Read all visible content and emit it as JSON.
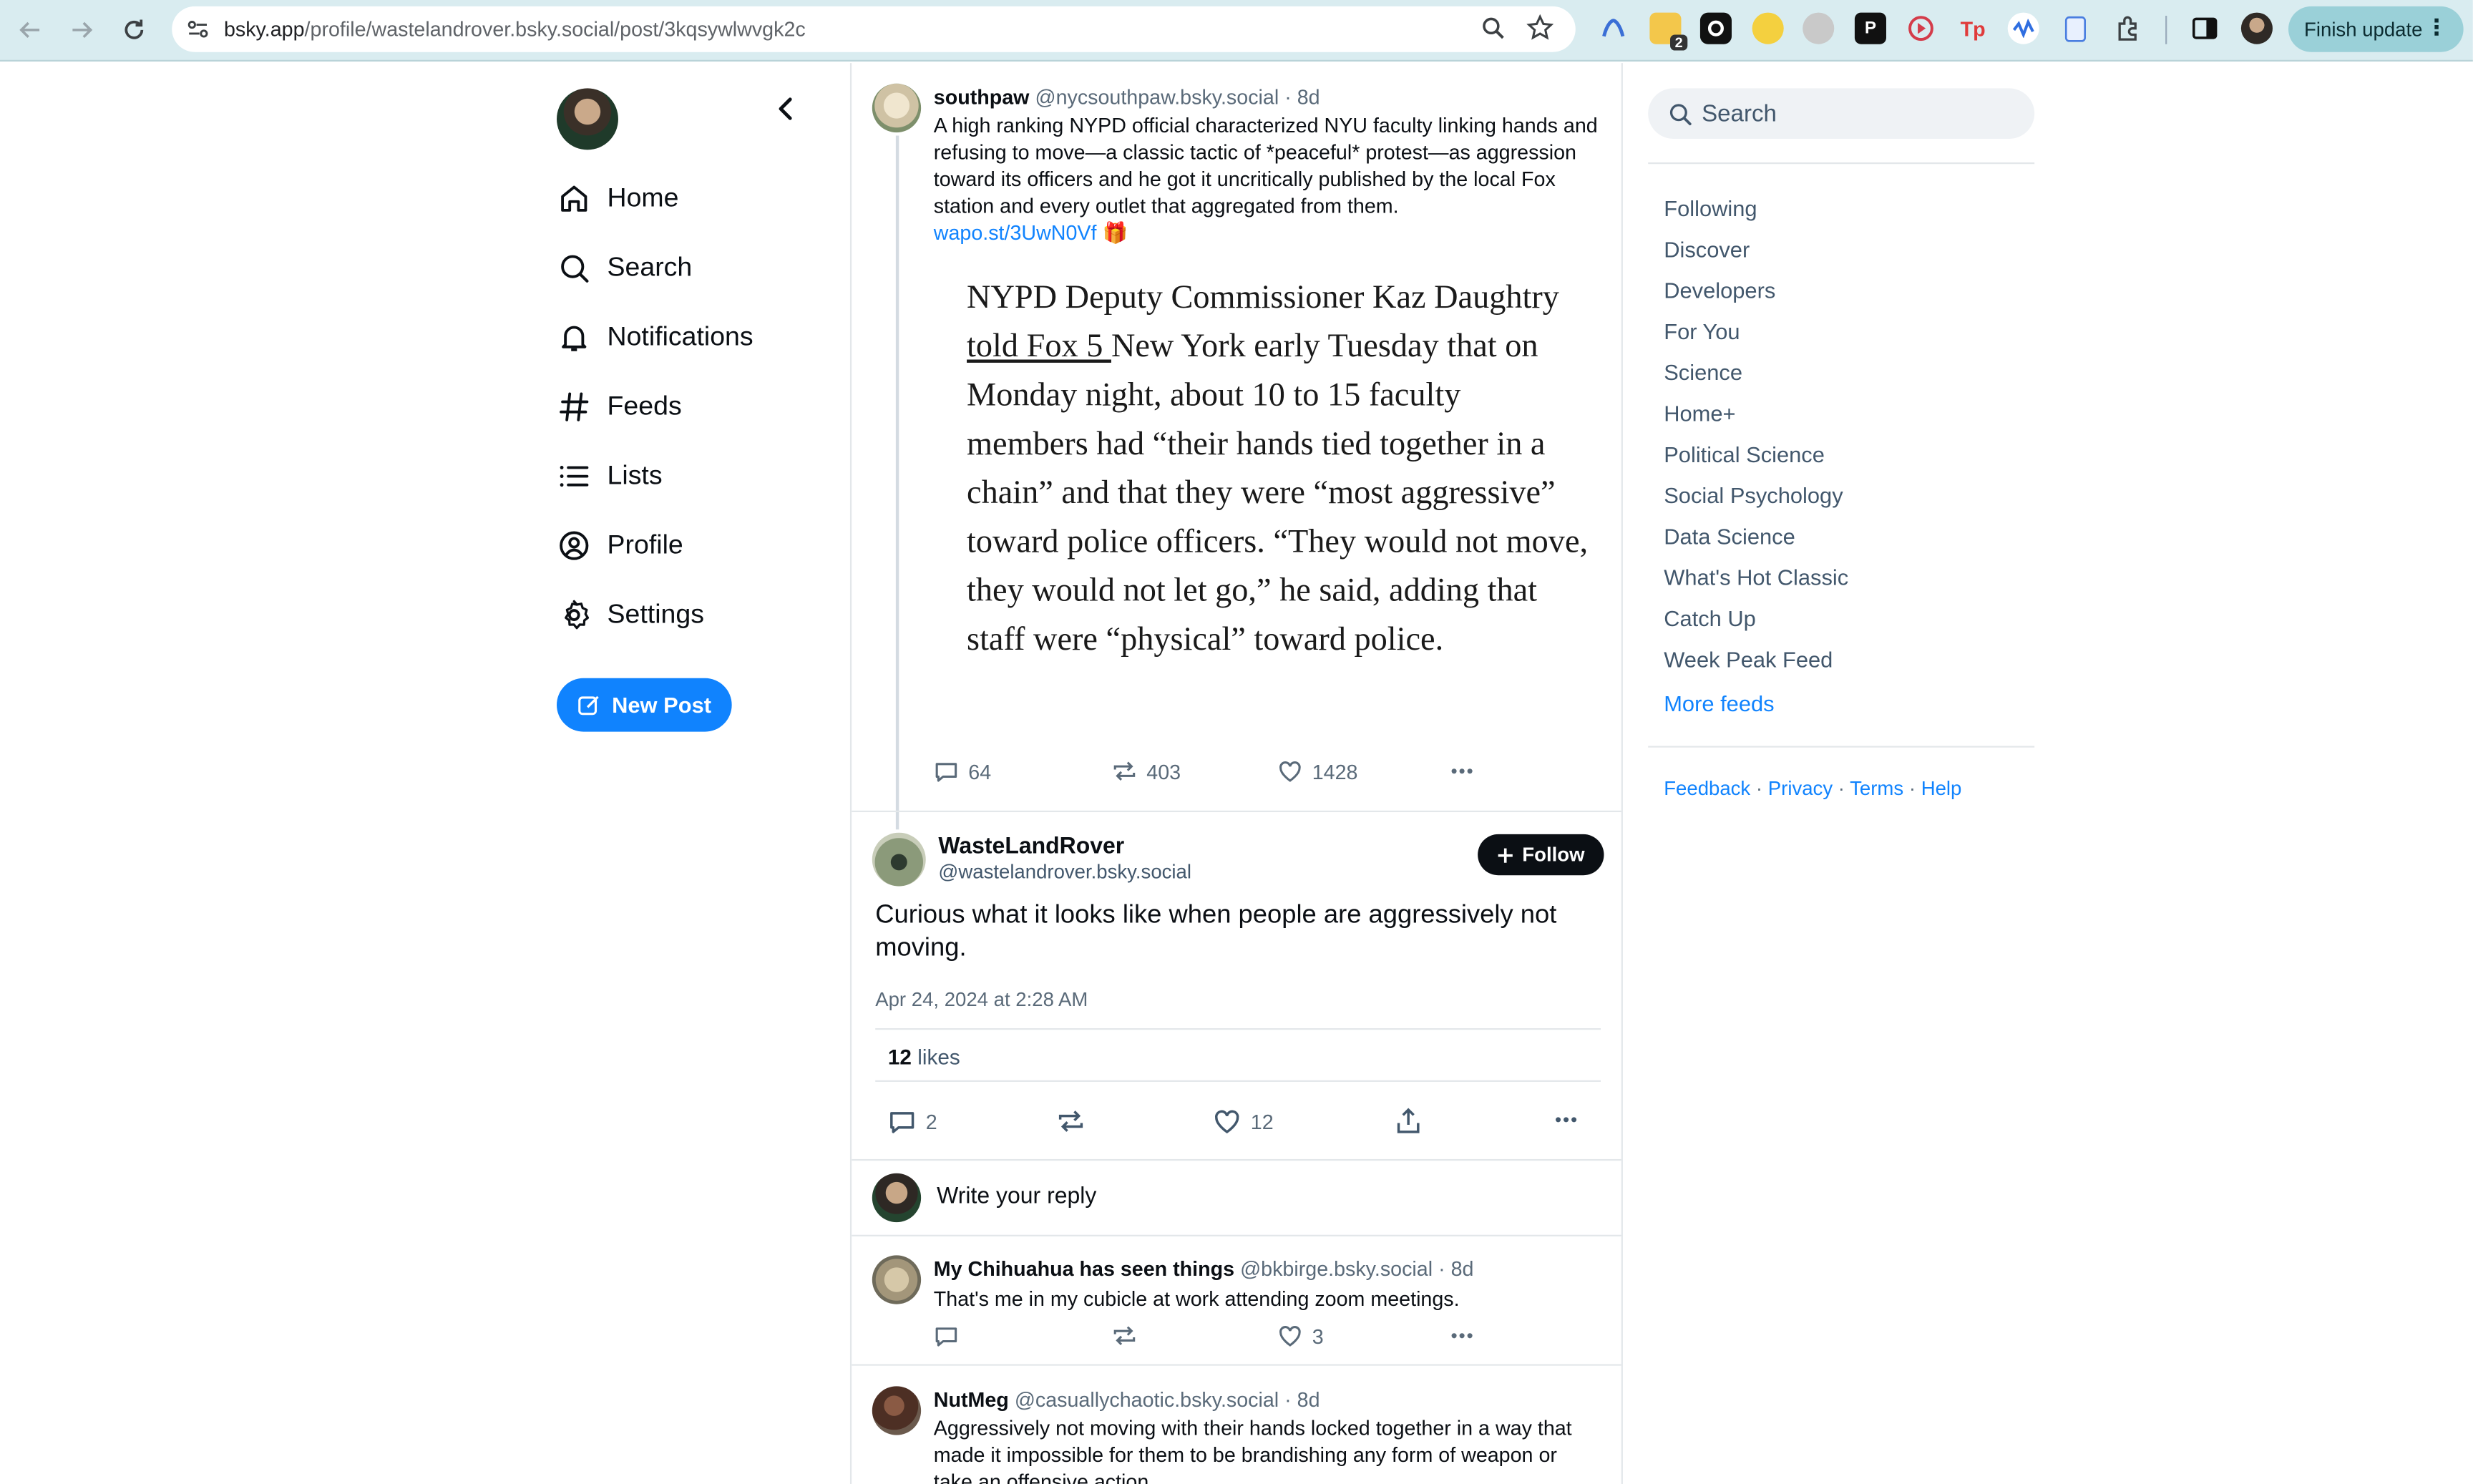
{
  "browser": {
    "url_host": "bsky.app",
    "url_path": "/profile/wastelandrover.bsky.social/post/3kqsywlwvgk2c",
    "finish_update_label": "Finish update",
    "ext_badge_count": "2"
  },
  "nav": {
    "items": [
      {
        "label": "Home",
        "icon": "home-icon"
      },
      {
        "label": "Search",
        "icon": "search-icon"
      },
      {
        "label": "Notifications",
        "icon": "bell-icon"
      },
      {
        "label": "Feeds",
        "icon": "hashtag-icon"
      },
      {
        "label": "Lists",
        "icon": "list-icon"
      },
      {
        "label": "Profile",
        "icon": "profile-icon"
      },
      {
        "label": "Settings",
        "icon": "gear-icon"
      }
    ],
    "new_post_label": "New Post"
  },
  "parent_post": {
    "author": "southpaw",
    "handle": "@nycsouthpaw.bsky.social",
    "age": "· 8d",
    "text": "A high ranking NYPD official characterized NYU faculty linking hands and refusing to move—a classic tactic of *peaceful* protest—as aggression toward its officers and he got it uncritically published by the local Fox station and every outlet that aggregated from them.",
    "link": "wapo.st/3UwN0Vf",
    "link_emoji": "🎁",
    "quote_before": "NYPD Deputy Commissioner Kaz Daughtry ",
    "quote_link": "told Fox 5 ",
    "quote_after": "New York early Tuesday that on Monday night, about 10 to 15 faculty members had “their hands tied together in a chain” and that they were “most aggressive” toward police officers. “They would not move, they would not let go,” he said, adding that staff were “physical” toward police.",
    "replies": "64",
    "reposts": "403",
    "likes": "1428"
  },
  "main_post": {
    "display_name": "WasteLandRover",
    "handle": "@wastelandrover.bsky.social",
    "follow_label": "Follow",
    "text": "Curious what it looks like when people are aggressively not moving.",
    "timestamp": "Apr 24, 2024 at 2:28 AM",
    "likes_count": "12",
    "likes_word": "likes",
    "replies": "2",
    "like_count_action": "12"
  },
  "reply_box": {
    "placeholder": "Write your reply"
  },
  "replies": [
    {
      "author": "My Chihuahua has seen things",
      "handle": "@bkbirge.bsky.social",
      "age": "· 8d",
      "text": "That's me in my cubicle at work attending zoom meetings.",
      "likes": "3"
    },
    {
      "author": "NutMeg",
      "handle": "@casuallychaotic.bsky.social",
      "age": "· 8d",
      "text": "Aggressively not moving with their hands locked together in a way that made it impossible for them to be brandishing any form of weapon or take an offensive action."
    }
  ],
  "right": {
    "search_placeholder": "Search",
    "feeds": [
      "Following",
      "Discover",
      "Developers",
      "For You",
      "Science",
      "Home+",
      "Political Science",
      "Social Psychology",
      "Data Science",
      "What's Hot Classic",
      "Catch Up",
      "Week Peak Feed"
    ],
    "more_feeds": "More feeds",
    "footer": [
      "Feedback",
      "Privacy",
      "Terms",
      "Help"
    ],
    "footer_sep": "·"
  }
}
